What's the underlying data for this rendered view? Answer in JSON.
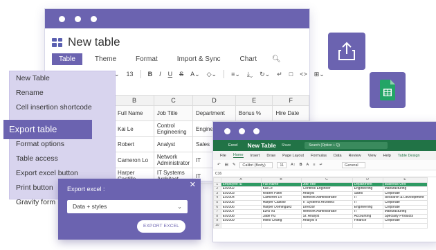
{
  "main_window": {
    "title": "New table",
    "tabs": [
      "Table",
      "Theme",
      "Format",
      "Import & Sync",
      "Chart"
    ],
    "toolbar": {
      "font_size": "13",
      "bold": "B",
      "italic": "I",
      "underline": "U",
      "strike": "S",
      "code": "<>"
    },
    "grid": {
      "columns": [
        "B",
        "C",
        "D",
        "E",
        "F"
      ],
      "headers": [
        "Full Name",
        "Job Title",
        "Department",
        "Bonus %",
        "Hire Date"
      ],
      "rows": [
        [
          "Kai Le",
          "Control Engineering",
          "Engineering",
          "",
          ""
        ],
        [
          "Robert",
          "Analyst",
          "Sales",
          "",
          ""
        ],
        [
          "Cameron Lo",
          "Network Administrator",
          "IT",
          "",
          ""
        ],
        [
          "Harper Castillo",
          "IT Systems Architect",
          "IT",
          "",
          ""
        ]
      ]
    }
  },
  "side_menu": {
    "items": [
      "New Table",
      "Rename",
      "Cell insertion shortcode",
      "Export table",
      "Format options",
      "Table access",
      "Export excel button",
      "Print button",
      "Gravity form"
    ]
  },
  "export_dialog": {
    "label": "Export excel :",
    "close": "✕",
    "selected_option": "Data + styles",
    "button": "EXPORT EXCEL"
  },
  "excel_window": {
    "app": "Excel",
    "title": "New Table",
    "share_hint": "Share",
    "search_placeholder": "Search (Option + Q)",
    "menu": [
      "File",
      "Home",
      "Insert",
      "Draw",
      "Page Layout",
      "Formulas",
      "Data",
      "Review",
      "View",
      "Help",
      "Table Design"
    ],
    "font": "Calibri (Body)",
    "font_size": "11",
    "number_format": "General",
    "cell_ref": "C16",
    "columns": [
      "",
      "A",
      "B",
      "C",
      "D",
      "E"
    ],
    "header_row": [
      "Employee ID",
      "Full Name",
      "Job Title",
      "Department",
      "Business Unit"
    ],
    "rows": [
      [
        "E02002",
        "Kai Le",
        "Controls Engineer",
        "Engineering",
        "Manufacturing"
      ],
      [
        "E02003",
        "Robert Patel",
        "Analyst",
        "Sales",
        "Corporate"
      ],
      [
        "E02004",
        "Cameron Lo",
        "Network Administrator",
        "IT",
        "Research & Development"
      ],
      [
        "E02005",
        "Harper Castillo",
        "IT Systems Architect",
        "IT",
        "Corporate"
      ],
      [
        "E02006",
        "Harper Dominguez",
        "Director",
        "Engineering",
        "Corporate"
      ],
      [
        "E02007",
        "Ezra Vu",
        "Network Administrator",
        "IT",
        "Manufacturing"
      ],
      [
        "E02008",
        "Jade Hu",
        "Sr. Analyst",
        "Accounting",
        "Specialty Products"
      ],
      [
        "E02009",
        "Miles Chang",
        "Analyst II",
        "Finance",
        "Corporate"
      ]
    ]
  },
  "colors": {
    "accent": "#6b63b0",
    "excel_green": "#217346",
    "table_header": "#2e9a63"
  }
}
